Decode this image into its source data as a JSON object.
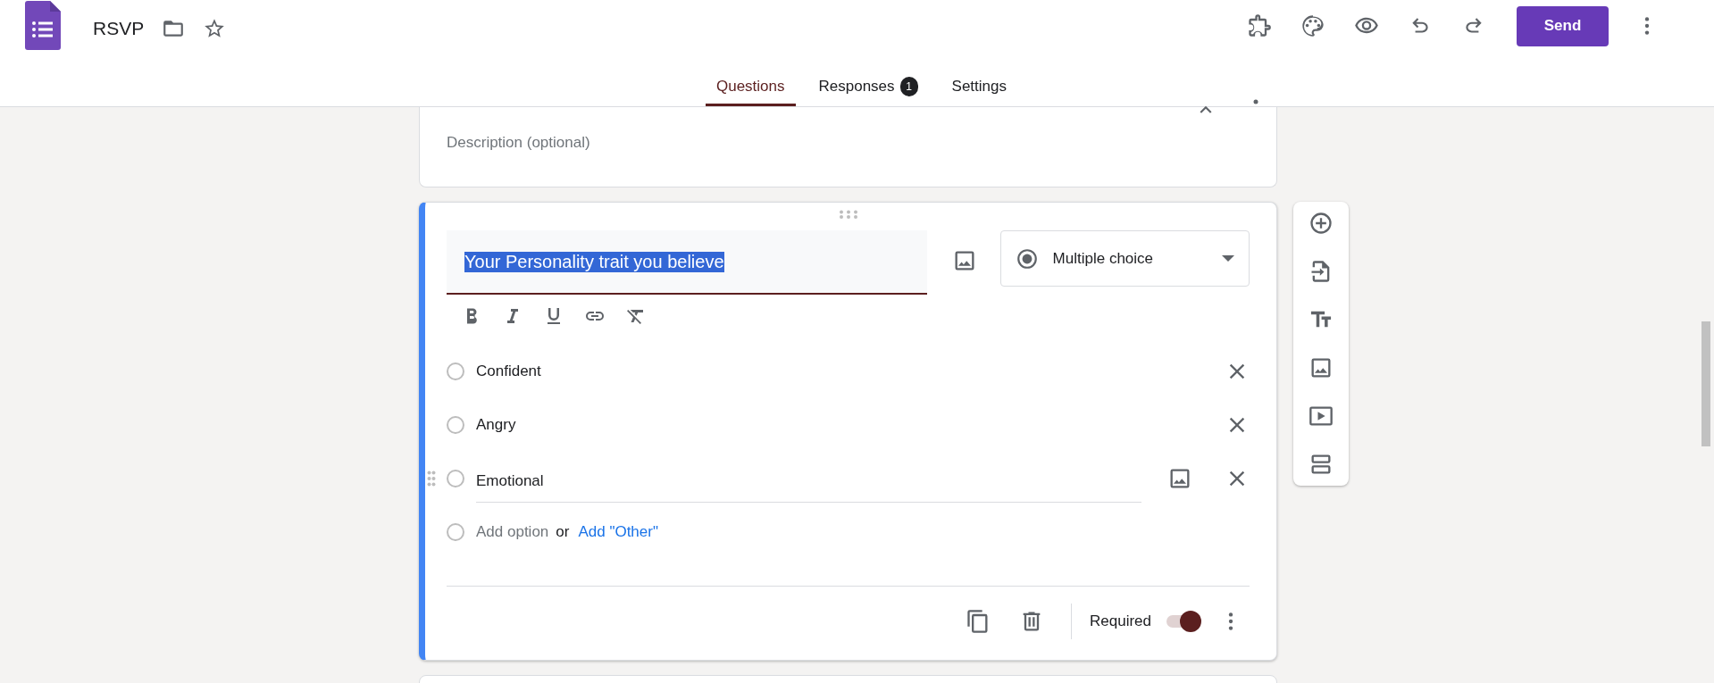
{
  "header": {
    "title": "RSVP",
    "send_button": "Send"
  },
  "tabs": [
    {
      "label": "Questions",
      "selected": true
    },
    {
      "label": "Responses",
      "selected": false,
      "badge": "1"
    },
    {
      "label": "Settings",
      "selected": false
    }
  ],
  "description_card": {
    "placeholder": "Description (optional)"
  },
  "question": {
    "title": "Your Personality trait you believe",
    "title_highlighted": true,
    "type": "Multiple choice",
    "options": [
      {
        "label": "Confident",
        "focused": false,
        "selected": false
      },
      {
        "label": "Angry",
        "focused": false,
        "selected": false
      },
      {
        "label": "Emotional",
        "focused": true,
        "selected": false
      }
    ],
    "add_option": {
      "selected": false,
      "placeholder": "Add option",
      "separator": "or",
      "other_link": "Add \"Other\""
    },
    "required": {
      "label": "Required",
      "on": true
    }
  }
}
